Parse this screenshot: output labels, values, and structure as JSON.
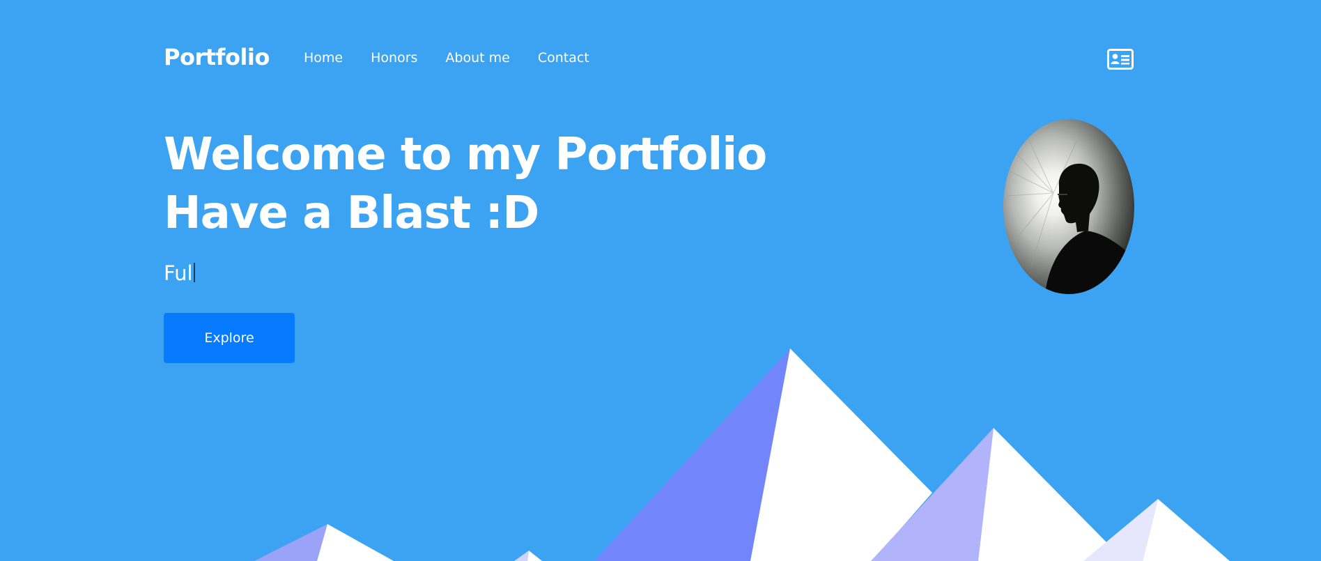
{
  "brand": "Portfolio",
  "nav": {
    "items": [
      {
        "label": "Home"
      },
      {
        "label": "Honors"
      },
      {
        "label": "About me"
      },
      {
        "label": "Contact"
      }
    ],
    "contact_card_icon": "id-card-icon"
  },
  "hero": {
    "title_line1": "Welcome to my Portfolio",
    "title_line2": "Have a Blast :D",
    "typed_text": "Ful",
    "explore_label": "Explore"
  },
  "avatar": {
    "icon": "profile-photo"
  },
  "colors": {
    "background": "#3ba3f2",
    "button": "#077bff",
    "mountain_dark": "#7385fb",
    "mountain_mid": "#b1b4fb",
    "mountain_light": "#e6e6fd",
    "mountain_far": "#9ba3f9",
    "snow": "#ffffff"
  }
}
